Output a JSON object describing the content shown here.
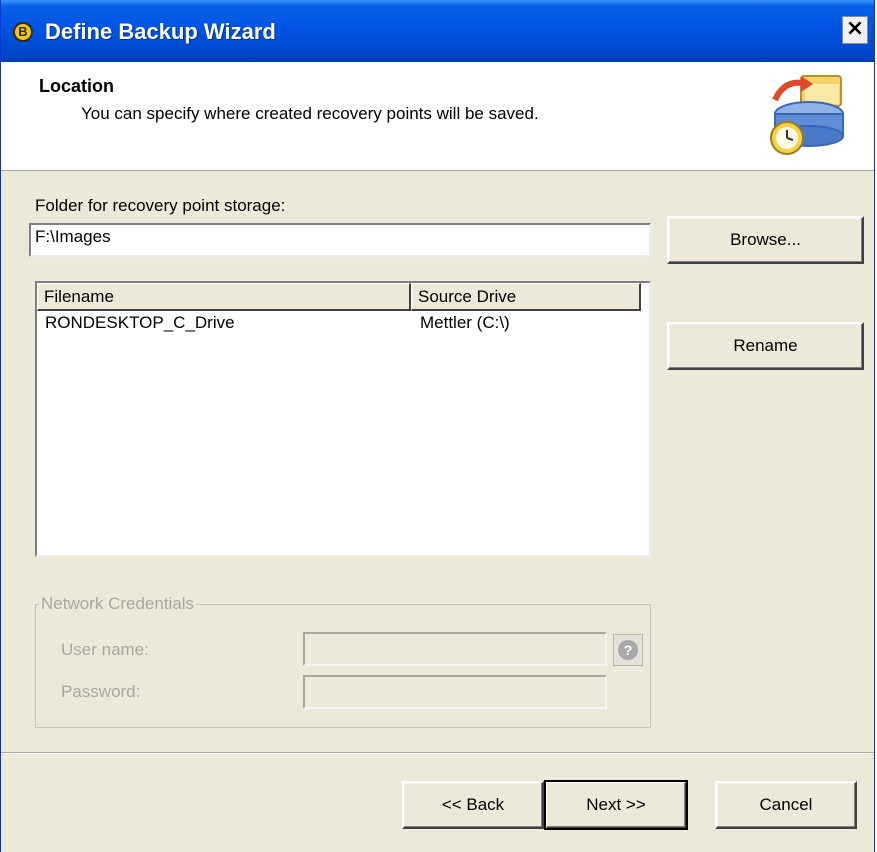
{
  "window": {
    "title": "Define Backup Wizard",
    "close_glyph": "×",
    "title_icon_glyph": "B"
  },
  "header": {
    "title": "Location",
    "subtitle": "You can specify where created recovery points will be saved."
  },
  "folder": {
    "label": "Folder for recovery point storage:",
    "value": "F:\\Images",
    "browse_label": "Browse..."
  },
  "list": {
    "columns": [
      "Filename",
      "Source Drive"
    ],
    "rows": [
      {
        "filename": "RONDESKTOP_C_Drive",
        "source_drive": "Mettler (C:\\)"
      }
    ],
    "rename_label": "Rename"
  },
  "network": {
    "legend": "Network Credentials",
    "user_label": "User name:",
    "password_label": "Password:",
    "user_value": "",
    "password_value": "",
    "help_glyph": "?"
  },
  "footer": {
    "back_label": "<< Back",
    "next_label": "Next >>",
    "cancel_label": "Cancel"
  },
  "colors": {
    "titlebar": "#0054e3",
    "dialog_bg": "#ece9d8",
    "disabled_text": "#a9a79c"
  },
  "icons": [
    "backup-app-icon",
    "close-icon",
    "backup-drive-icon",
    "help-icon"
  ]
}
